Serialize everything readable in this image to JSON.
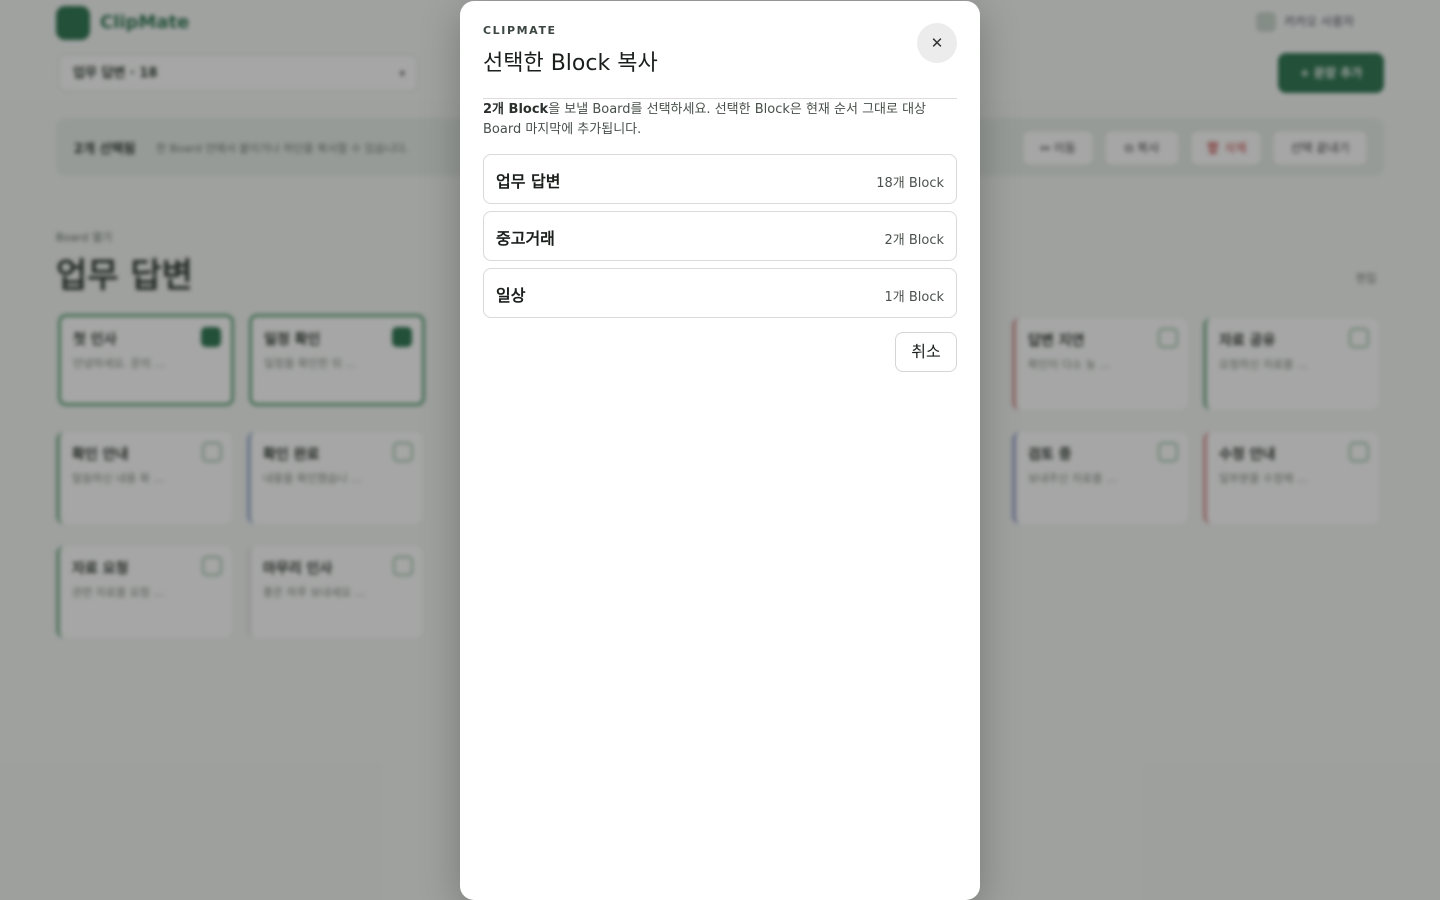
{
  "background": {
    "app_name": "ClipMate",
    "user_menu": "카카오 사용자",
    "board_select": "업무 답변 · 18",
    "new_button": "+ 문장 추가",
    "selection_count": "2개 선택됨",
    "selection_hint": "한 Board 안에서 붙이거나 하단을 복사할 수 있습니다.",
    "selection_actions": [
      "↔ 이동",
      "⧉ 복사",
      "🗑 삭제",
      "선택 끝내기"
    ],
    "eyebrow": "Board 열기",
    "board_title": "업무 답변",
    "edit_link": "편집",
    "cards": [
      {
        "title": "첫 인사",
        "snippet": "안녕하세요. 문의 …"
      },
      {
        "title": "일정 확인",
        "snippet": "일정을 확인한 뒤 …"
      },
      {
        "title": "답변 지연",
        "snippet": "확인이 다소 늦 …"
      },
      {
        "title": "자료 공유",
        "snippet": "요청하신 자료를 …"
      },
      {
        "title": "확인 안내",
        "snippet": "말씀하신 내용 확 …"
      },
      {
        "title": "확인 완료",
        "snippet": "내용을 확인했습니 …"
      },
      {
        "title": "검토 중",
        "snippet": "보내주신 자료를 …"
      },
      {
        "title": "수정 안내",
        "snippet": "일부분을 수정해 …"
      },
      {
        "title": "자료 요청",
        "snippet": "관련 자료를 요청 …"
      },
      {
        "title": "마무리 인사",
        "snippet": "좋은 하루 보내세요 …"
      }
    ]
  },
  "modal": {
    "eyebrow": "CLIPMATE",
    "title": "선택한 Block 복사",
    "close_icon": "close-icon",
    "desc_bold": "2개 Block",
    "desc_rest": "을 보낼 Board를 선택하세요. 선택한 Block은 현재 순서 그대로 대상 Board 마지막에 추가됩니다.",
    "options": [
      {
        "name": "업무 답변",
        "count": "18개 Block"
      },
      {
        "name": "중고거래",
        "count": "2개 Block"
      },
      {
        "name": "일상",
        "count": "1개 Block"
      }
    ],
    "cancel_label": "취소"
  }
}
